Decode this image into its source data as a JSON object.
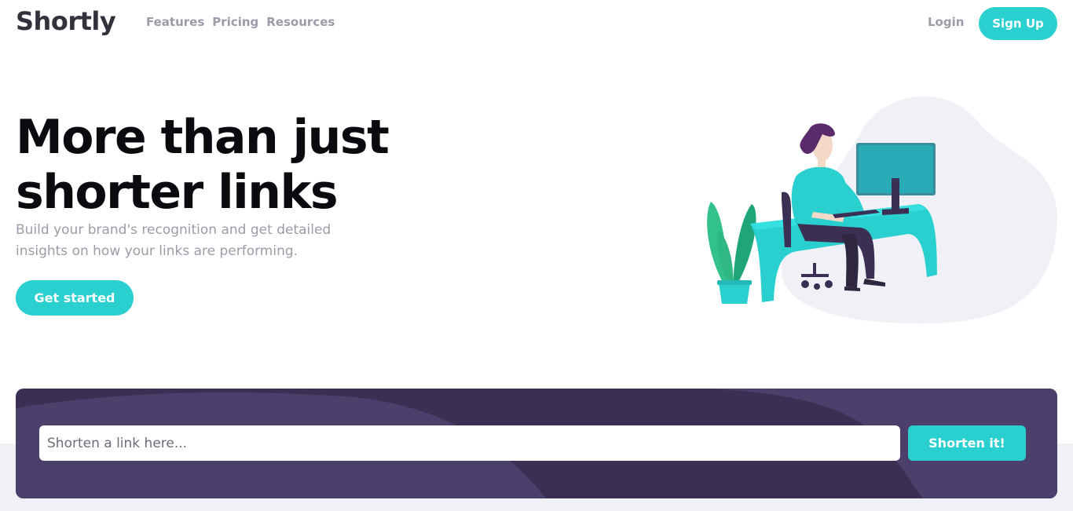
{
  "header": {
    "logo": "Shortly",
    "nav": [
      {
        "label": "Features"
      },
      {
        "label": "Pricing"
      },
      {
        "label": "Resources"
      }
    ],
    "login_label": "Login",
    "signup_label": "Sign Up"
  },
  "hero": {
    "title_line1": "More than just",
    "title_line2": "shorter links",
    "subtitle": "Build your brand's recognition and get detailed insights on how your links are performing.",
    "cta_label": "Get started",
    "illustration_icon": "person-working-illustration"
  },
  "shorten": {
    "placeholder": "Shorten a link here...",
    "button_label": "Shorten it!"
  },
  "colors": {
    "accent": "#2acfcf",
    "dark_violet": "#3b3054",
    "gray": "#9e9aa7",
    "very_dark": "#34313d"
  }
}
